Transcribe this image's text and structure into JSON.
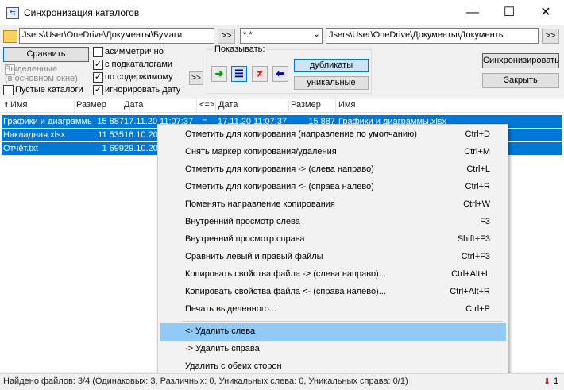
{
  "window": {
    "title": "Синхронизация каталогов",
    "minimize_glyph": "—",
    "maximize_glyph": "☐",
    "close_glyph": "✕"
  },
  "paths": {
    "left": "Jsers\\User\\OneDrive\\Документы\\Бумаги",
    "mask": "*.*",
    "right": "Jsers\\User\\OneDrive\\Документы\\Документы",
    "browse_left": ">>",
    "browse_right": ">>",
    "mask_dropdown_glyph": "⌄"
  },
  "options": {
    "compare_label": "Сравнить",
    "selected_label": "Выделенные",
    "selected_sub": "(в основном окне)",
    "empty_dirs_label": "Пустые каталоги",
    "asymmetric_label": "асимметрично",
    "subdirs_label": "с подкаталогами",
    "by_content_label": "по содержимому",
    "ignore_date_label": "игнорировать дату",
    "check_glyph": "✓",
    "more_label": ">>"
  },
  "show": {
    "legend": "Показывать:",
    "right_arrow": "➜",
    "equal_sign": "☰",
    "not_equal": "≠",
    "left_arrow": "⬅",
    "duplicates_label": "дубликаты",
    "unique_label": "уникальные",
    "colors": {
      "right": "#00a000",
      "not_equal": "#d00000",
      "left": "#0000d0"
    }
  },
  "actions": {
    "sync_label": "Синхронизировать",
    "close_label": "Закрыть"
  },
  "columns": {
    "name_left": "Имя",
    "size_left": "Размер",
    "date_left": "Дата",
    "direction": "<=>",
    "date_right": "Дата",
    "size_right": "Размер",
    "name_right": "Имя",
    "sort_glyph": "⬆"
  },
  "rows": [
    {
      "name": "Графики и диаграммы",
      "size": "15 887",
      "date": "17.11.20 11:07:37",
      "dir": "=",
      "rdate": "17.11.20 11:07:37",
      "rsize": "15 887",
      "rname": "Графики и диаграммы.xlsx"
    },
    {
      "name": "Накладная.xlsx",
      "size": "11 535",
      "date": "16.10.20",
      "dir": "",
      "rdate": "",
      "rsize": "",
      "rname": ""
    },
    {
      "name": "Отчёт.txt",
      "size": "1 699",
      "date": "29.10.20",
      "dir": "",
      "rdate": "",
      "rsize": "",
      "rname": ""
    }
  ],
  "context_menu": {
    "items": [
      {
        "label": "Отметить для копирования (направление по умолчанию)",
        "shortcut": "Ctrl+D"
      },
      {
        "label": "Снять маркер копирования/удаления",
        "shortcut": "Ctrl+M"
      },
      {
        "label": "Отметить для копирования -> (слева направо)",
        "shortcut": "Ctrl+L"
      },
      {
        "label": "Отметить для копирования <- (справа налево)",
        "shortcut": "Ctrl+R"
      },
      {
        "label": "Поменять направление копирования",
        "shortcut": "Ctrl+W"
      },
      {
        "label": "Внутренний просмотр слева",
        "shortcut": "F3"
      },
      {
        "label": "Внутренний просмотр справа",
        "shortcut": "Shift+F3"
      },
      {
        "label": "Сравнить левый и правый файлы",
        "shortcut": "Ctrl+F3"
      },
      {
        "label": "Копировать свойства файла -> (слева направо)...",
        "shortcut": "Ctrl+Alt+L"
      },
      {
        "label": "Копировать свойства файла <- (справа налево)...",
        "shortcut": "Ctrl+Alt+R"
      },
      {
        "label": "Печать выделенного...",
        "shortcut": "Ctrl+P"
      },
      {
        "label": "<- Удалить слева",
        "shortcut": ""
      },
      {
        "label": "-> Удалить справа",
        "shortcut": ""
      },
      {
        "label": "Удалить с обеих сторон",
        "shortcut": ""
      }
    ]
  },
  "status": {
    "text": "Найдено файлов: 3/4  (Одинаковых: 3, Различных: 0, Уникальных слева: 0, Уникальных справа: 0/1)",
    "count": "1"
  }
}
